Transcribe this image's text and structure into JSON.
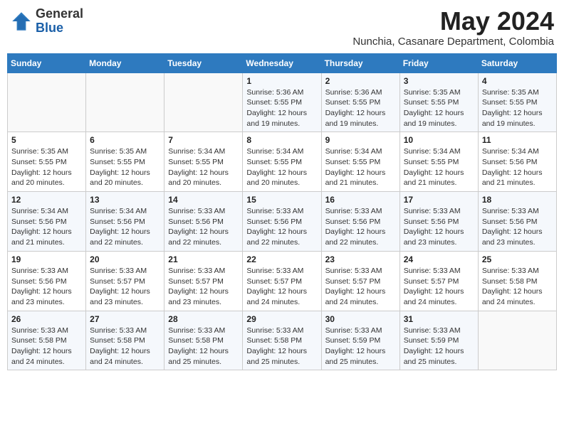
{
  "header": {
    "logo": {
      "general": "General",
      "blue": "Blue"
    },
    "title": "May 2024",
    "location": "Nunchia, Casanare Department, Colombia"
  },
  "days_of_week": [
    "Sunday",
    "Monday",
    "Tuesday",
    "Wednesday",
    "Thursday",
    "Friday",
    "Saturday"
  ],
  "weeks": [
    [
      {
        "day": "",
        "info": ""
      },
      {
        "day": "",
        "info": ""
      },
      {
        "day": "",
        "info": ""
      },
      {
        "day": "1",
        "info": "Sunrise: 5:36 AM\nSunset: 5:55 PM\nDaylight: 12 hours and 19 minutes."
      },
      {
        "day": "2",
        "info": "Sunrise: 5:36 AM\nSunset: 5:55 PM\nDaylight: 12 hours and 19 minutes."
      },
      {
        "day": "3",
        "info": "Sunrise: 5:35 AM\nSunset: 5:55 PM\nDaylight: 12 hours and 19 minutes."
      },
      {
        "day": "4",
        "info": "Sunrise: 5:35 AM\nSunset: 5:55 PM\nDaylight: 12 hours and 19 minutes."
      }
    ],
    [
      {
        "day": "5",
        "info": "Sunrise: 5:35 AM\nSunset: 5:55 PM\nDaylight: 12 hours and 20 minutes."
      },
      {
        "day": "6",
        "info": "Sunrise: 5:35 AM\nSunset: 5:55 PM\nDaylight: 12 hours and 20 minutes."
      },
      {
        "day": "7",
        "info": "Sunrise: 5:34 AM\nSunset: 5:55 PM\nDaylight: 12 hours and 20 minutes."
      },
      {
        "day": "8",
        "info": "Sunrise: 5:34 AM\nSunset: 5:55 PM\nDaylight: 12 hours and 20 minutes."
      },
      {
        "day": "9",
        "info": "Sunrise: 5:34 AM\nSunset: 5:55 PM\nDaylight: 12 hours and 21 minutes."
      },
      {
        "day": "10",
        "info": "Sunrise: 5:34 AM\nSunset: 5:55 PM\nDaylight: 12 hours and 21 minutes."
      },
      {
        "day": "11",
        "info": "Sunrise: 5:34 AM\nSunset: 5:56 PM\nDaylight: 12 hours and 21 minutes."
      }
    ],
    [
      {
        "day": "12",
        "info": "Sunrise: 5:34 AM\nSunset: 5:56 PM\nDaylight: 12 hours and 21 minutes."
      },
      {
        "day": "13",
        "info": "Sunrise: 5:34 AM\nSunset: 5:56 PM\nDaylight: 12 hours and 22 minutes."
      },
      {
        "day": "14",
        "info": "Sunrise: 5:33 AM\nSunset: 5:56 PM\nDaylight: 12 hours and 22 minutes."
      },
      {
        "day": "15",
        "info": "Sunrise: 5:33 AM\nSunset: 5:56 PM\nDaylight: 12 hours and 22 minutes."
      },
      {
        "day": "16",
        "info": "Sunrise: 5:33 AM\nSunset: 5:56 PM\nDaylight: 12 hours and 22 minutes."
      },
      {
        "day": "17",
        "info": "Sunrise: 5:33 AM\nSunset: 5:56 PM\nDaylight: 12 hours and 23 minutes."
      },
      {
        "day": "18",
        "info": "Sunrise: 5:33 AM\nSunset: 5:56 PM\nDaylight: 12 hours and 23 minutes."
      }
    ],
    [
      {
        "day": "19",
        "info": "Sunrise: 5:33 AM\nSunset: 5:56 PM\nDaylight: 12 hours and 23 minutes."
      },
      {
        "day": "20",
        "info": "Sunrise: 5:33 AM\nSunset: 5:57 PM\nDaylight: 12 hours and 23 minutes."
      },
      {
        "day": "21",
        "info": "Sunrise: 5:33 AM\nSunset: 5:57 PM\nDaylight: 12 hours and 23 minutes."
      },
      {
        "day": "22",
        "info": "Sunrise: 5:33 AM\nSunset: 5:57 PM\nDaylight: 12 hours and 24 minutes."
      },
      {
        "day": "23",
        "info": "Sunrise: 5:33 AM\nSunset: 5:57 PM\nDaylight: 12 hours and 24 minutes."
      },
      {
        "day": "24",
        "info": "Sunrise: 5:33 AM\nSunset: 5:57 PM\nDaylight: 12 hours and 24 minutes."
      },
      {
        "day": "25",
        "info": "Sunrise: 5:33 AM\nSunset: 5:58 PM\nDaylight: 12 hours and 24 minutes."
      }
    ],
    [
      {
        "day": "26",
        "info": "Sunrise: 5:33 AM\nSunset: 5:58 PM\nDaylight: 12 hours and 24 minutes."
      },
      {
        "day": "27",
        "info": "Sunrise: 5:33 AM\nSunset: 5:58 PM\nDaylight: 12 hours and 24 minutes."
      },
      {
        "day": "28",
        "info": "Sunrise: 5:33 AM\nSunset: 5:58 PM\nDaylight: 12 hours and 25 minutes."
      },
      {
        "day": "29",
        "info": "Sunrise: 5:33 AM\nSunset: 5:58 PM\nDaylight: 12 hours and 25 minutes."
      },
      {
        "day": "30",
        "info": "Sunrise: 5:33 AM\nSunset: 5:59 PM\nDaylight: 12 hours and 25 minutes."
      },
      {
        "day": "31",
        "info": "Sunrise: 5:33 AM\nSunset: 5:59 PM\nDaylight: 12 hours and 25 minutes."
      },
      {
        "day": "",
        "info": ""
      }
    ]
  ]
}
